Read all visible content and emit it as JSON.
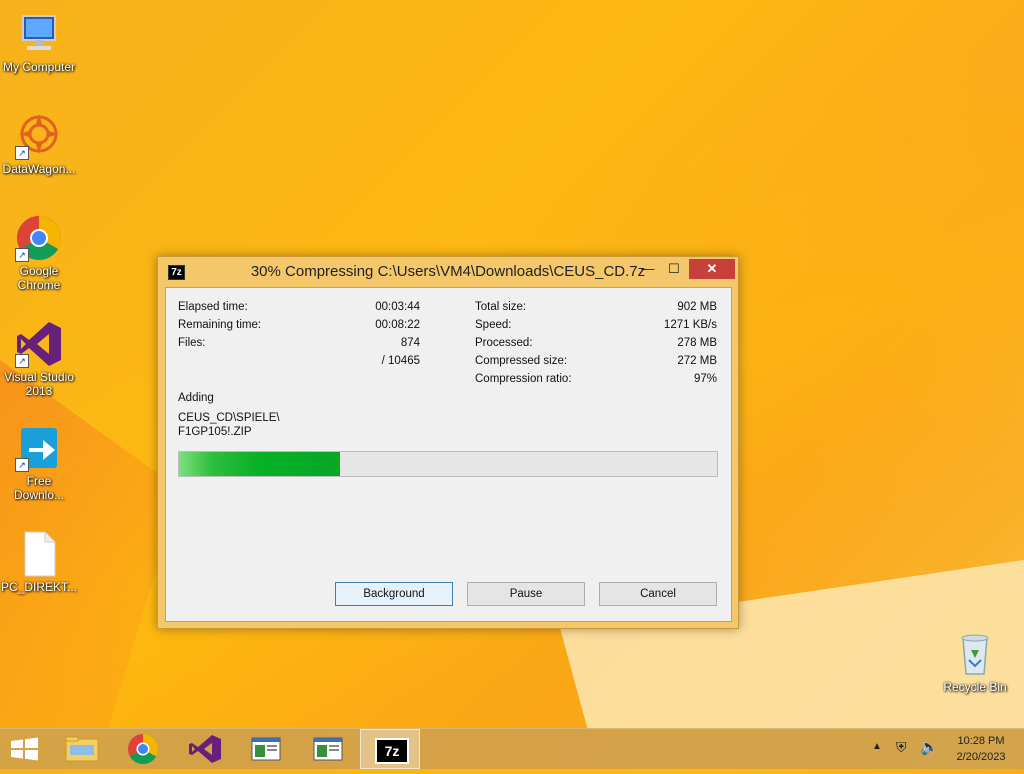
{
  "desktop": {
    "icons": [
      {
        "label": "My Computer"
      },
      {
        "label": "DataWagon..."
      },
      {
        "label": "Google Chrome"
      },
      {
        "label": "Visual Studio 2013"
      },
      {
        "label": "Free Downlo..."
      },
      {
        "label": "PC_DIREKT..."
      },
      {
        "label": "Recycle Bin"
      }
    ]
  },
  "dialog": {
    "title": "30% Compressing C:\\Users\\VM4\\Downloads\\CEUS_CD.7z",
    "app_icon_text": "7z",
    "stats_left": {
      "elapsed_label": "Elapsed time:",
      "elapsed_value": "00:03:44",
      "remaining_label": "Remaining time:",
      "remaining_value": "00:08:22",
      "files_label": "Files:",
      "files_value": "874",
      "files_total": "/ 10465"
    },
    "stats_right": {
      "total_label": "Total size:",
      "total_value": "902 MB",
      "speed_label": "Speed:",
      "speed_value": "1271 KB/s",
      "processed_label": "Processed:",
      "processed_value": "278 MB",
      "compressed_label": "Compressed size:",
      "compressed_value": "272 MB",
      "ratio_label": "Compression ratio:",
      "ratio_value": "97%"
    },
    "operation": "Adding",
    "current_path_line1": "CEUS_CD\\SPIELE\\",
    "current_path_line2": "F1GP105!.ZIP",
    "progress_percent": 30,
    "buttons": {
      "background": "Background",
      "pause": "Pause",
      "cancel": "Cancel"
    }
  },
  "taskbar": {
    "clock_time": "10:28 PM",
    "clock_date": "2/20/2023",
    "active_app_icon_text": "7z"
  },
  "colors": {
    "desktop_bg": "#fdb813",
    "progress_green": "#06a826",
    "close_red": "#c7413a"
  }
}
